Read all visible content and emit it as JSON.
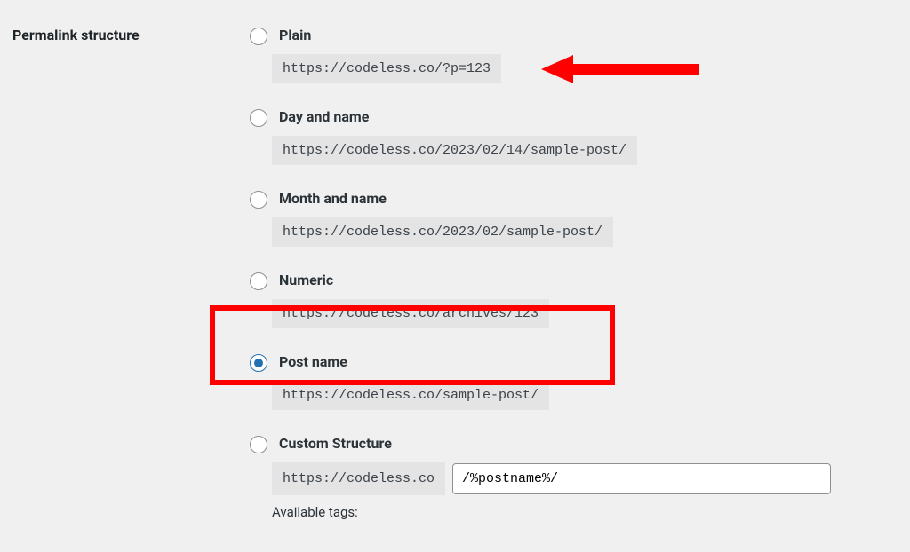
{
  "section_title": "Permalink structure",
  "options": {
    "plain": {
      "label": "Plain",
      "example": "https://codeless.co/?p=123"
    },
    "day_name": {
      "label": "Day and name",
      "example": "https://codeless.co/2023/02/14/sample-post/"
    },
    "month_name": {
      "label": "Month and name",
      "example": "https://codeless.co/2023/02/sample-post/"
    },
    "numeric": {
      "label": "Numeric",
      "example": "https://codeless.co/archives/123"
    },
    "post_name": {
      "label": "Post name",
      "example": "https://codeless.co/sample-post/"
    },
    "custom": {
      "label": "Custom Structure",
      "prefix": "https://codeless.co",
      "value": "/%postname%/",
      "available_tags_label": "Available tags:"
    }
  }
}
